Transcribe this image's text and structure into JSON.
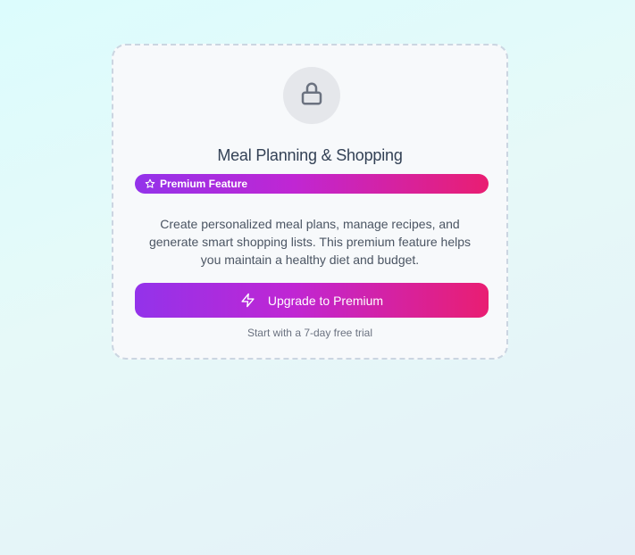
{
  "card": {
    "title": "Meal Planning & Shopping",
    "badge_label": "Premium Feature",
    "description": "Create personalized meal plans, manage recipes, and generate smart shopping lists. This premium feature helps you maintain a healthy diet and budget.",
    "upgrade_label": "Upgrade to Premium",
    "trial_note": "Start with a 7-day free trial",
    "icons": {
      "lock": "lock-icon",
      "star": "star-icon",
      "bolt": "lightning-bolt-icon"
    }
  },
  "colors": {
    "gradient_start": "#9333ea",
    "gradient_mid": "#c026d3",
    "gradient_end": "#e91e72",
    "title": "#334155",
    "body_text": "#4b5563",
    "muted_text": "#6b7280",
    "lock_bg": "#e5e7eb",
    "card_border": "#cbd5e1"
  }
}
